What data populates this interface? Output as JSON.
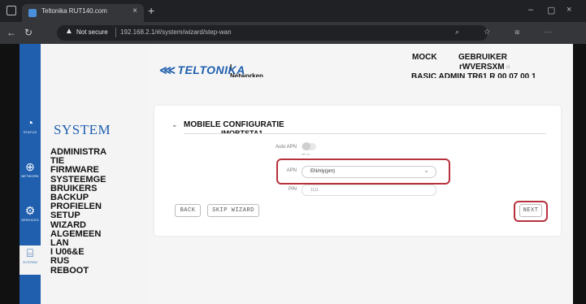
{
  "browser": {
    "tab_title": "Teltonika RUT140.com",
    "tab_close": "×",
    "new_tab": "+",
    "not_secure": "Not secure",
    "url": "192.168.2.1/#/system/wizard/step-wan",
    "window_controls": [
      "–",
      "▢",
      "×"
    ]
  },
  "nav": {
    "items": [
      {
        "icon": "speedometer-icon",
        "label": "STATUS"
      },
      {
        "icon": "globe-icon",
        "label": "NETWORK"
      },
      {
        "icon": "gear-icon",
        "label": "SERVICES"
      },
      {
        "icon": "code-icon",
        "label": "SYSTEM"
      }
    ]
  },
  "sidebar": {
    "title": "SYSTEM",
    "items": [
      "ADMINISTRA",
      "TIE",
      "FIRMWARE",
      "SYSTEEMGE",
      "BRUIKERS",
      "BACKUP",
      "PROFIELEN",
      "SETUP",
      "WIZARD",
      "ALGEMEEN",
      "LAN",
      "I U06&E",
      "RUS",
      "REBOOT"
    ]
  },
  "header": {
    "logo": "TELTONIKA",
    "logo_sub": "I",
    "logo_sub2": "Networken",
    "mock": "MOCK",
    "user": "GEBRUIKER",
    "device": "rWVERSXM",
    "device_extra": "r1",
    "version": "BASIC ADMIN TR61 R 00 07 00 1"
  },
  "wizard": {
    "title": "MOBIELE CONFIGURATIE",
    "title2": "IMOBTSTA1",
    "auto_apn_label": "Auto APN",
    "auto_apn_state": "off on",
    "apn_label": "APN",
    "apn_value": "EN/nly(pm)",
    "pin_label": "PIN",
    "pin_value": "1111",
    "back": "BACK",
    "skip": "SKIP WIZARD",
    "next": "NEXT"
  },
  "colors": {
    "accent": "#1f5fae",
    "highlight": "#b8323c"
  }
}
